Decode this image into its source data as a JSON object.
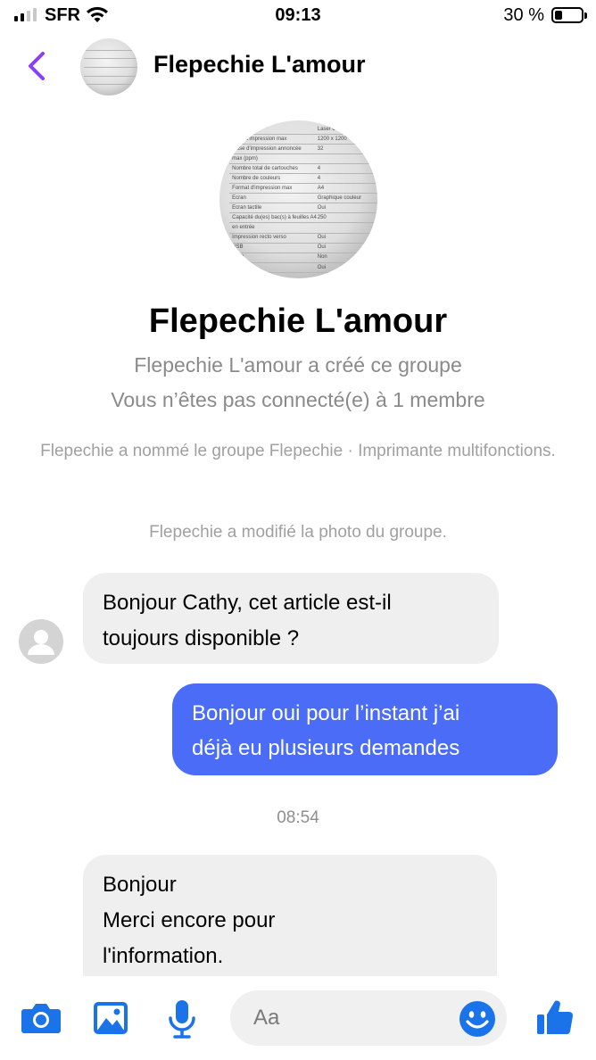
{
  "status_bar": {
    "carrier": "SFR",
    "time": "09:13",
    "battery_percent": "30 %",
    "battery_level": 0.3,
    "signal_bars_active": 2,
    "signal_bars_total": 4
  },
  "header": {
    "title": "Flepechie L'amour",
    "back_icon": "chevron-left-icon",
    "accent_color": "#8a3ffc"
  },
  "group_info": {
    "name": "Flepechie L'amour",
    "created_by": "Flepechie L'amour a créé ce groupe",
    "connection": "Vous n’êtes pas connecté(e) à 1 membre"
  },
  "events": {
    "renamed": "Flepechie a nommé le groupe Flepechie · Imprimante multifonctions.",
    "photo_changed": "Flepechie a modifié la photo du groupe."
  },
  "photo_text": {
    "rows": [
      [
        "impression",
        "Laser c"
      ],
      [
        "ution d'impression max",
        "1200 x 1200"
      ],
      [
        "tesse d'impression annoncée",
        "32"
      ],
      [
        "max (ppm)",
        ""
      ],
      [
        "Nombre total de cartouches",
        "4"
      ],
      [
        "Nombre de couleurs",
        "4"
      ],
      [
        "Format d'impression max",
        "A4"
      ],
      [
        "Ecran",
        "Graphique couleur"
      ],
      [
        "Ecran tactile",
        "Oui"
      ],
      [
        "Capacité du(es) bac(s) à feuilles A4",
        "250"
      ],
      [
        "en entrée",
        ""
      ],
      [
        "Impression recto verso",
        "Oui"
      ],
      [
        "USB",
        "Oui"
      ],
      [
        "tooth",
        "Non"
      ],
      [
        "",
        "Oui"
      ]
    ]
  },
  "messages": [
    {
      "direction": "incoming",
      "lines": [
        "Bonjour Cathy, cet article est-il",
        "toujours disponible ?"
      ]
    },
    {
      "direction": "outgoing",
      "lines": [
        "Bonjour oui pour l’instant j’ai",
        "déjà eu plusieurs demandes"
      ]
    },
    {
      "timestamp": "08:54"
    },
    {
      "direction": "incoming",
      "lines": [
        "Bonjour",
        "Merci encore pour",
        "l'information."
      ]
    }
  ],
  "colors": {
    "outgoing_bubble": "#4a6cf6",
    "incoming_bubble": "#efefef",
    "icon_blue": "#1a73e8"
  },
  "composer": {
    "placeholder": "Aa",
    "icons": [
      "camera-icon",
      "gallery-icon",
      "microphone-icon",
      "emoji-icon",
      "thumbs-up-icon"
    ]
  }
}
